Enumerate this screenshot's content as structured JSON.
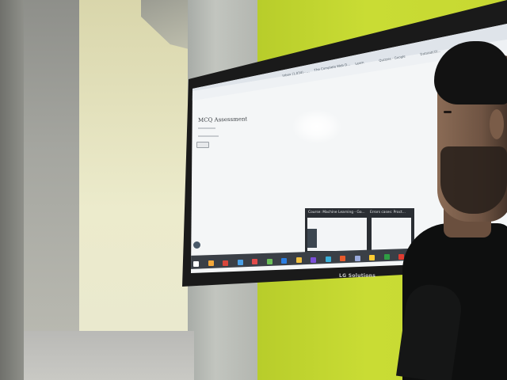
{
  "scene": {
    "description_free": true
  },
  "browser": {
    "tabs": [
      "Inbox (1,034) - ...",
      "The Complete Web D...",
      "Learn",
      "Quizzes - Google",
      "Datatab(O)..."
    ],
    "page_title": "MCQ Assessment"
  },
  "preview": {
    "items": [
      {
        "title": "Course: Machine Learning - Go..."
      },
      {
        "title": "Errors cases: Proct..."
      }
    ]
  },
  "monitor": {
    "brand": "LG Solutions"
  },
  "taskbar": {
    "icon_colors": [
      "#ffffff",
      "#f4a83a",
      "#d6453b",
      "#4aa0e6",
      "#e04a4a",
      "#6bbf59",
      "#2a7de1",
      "#f0c040",
      "#7b4fd8",
      "#3bb0d9",
      "#e85a2b",
      "#9ad",
      "#ffcc33",
      "#2f9e44",
      "#e03c31",
      "#0078d4",
      "#ff8c00"
    ]
  }
}
